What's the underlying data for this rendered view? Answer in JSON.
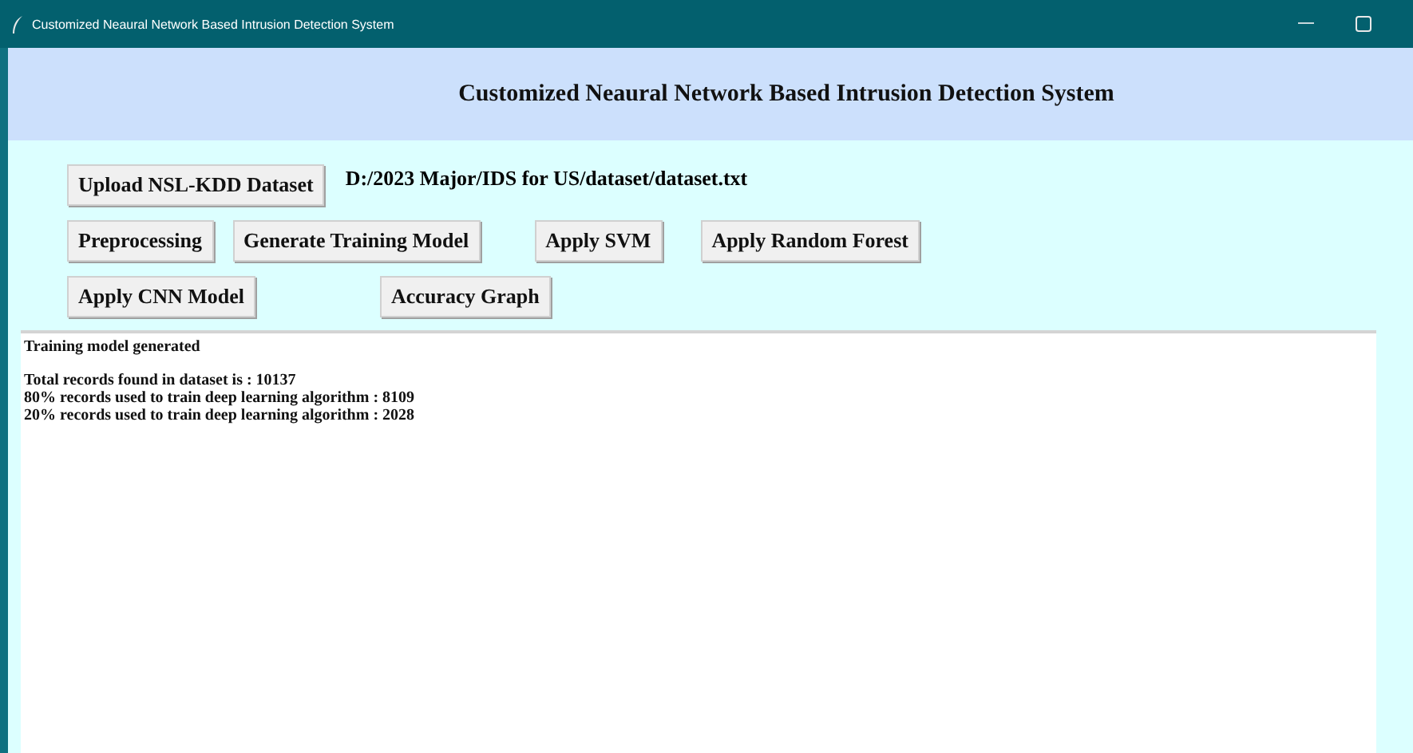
{
  "window": {
    "title": "Customized Neaural Network Based Intrusion Detection System"
  },
  "heading": "Customized Neaural Network Based Intrusion Detection System",
  "button_rows": [
    {
      "buttons": [
        "Upload NSL-KDD Dataset"
      ],
      "path": "D:/2023 Major/IDS for US/dataset/dataset.txt"
    },
    {
      "buttons": [
        "Preprocessing",
        "Generate Training Model",
        "Apply SVM",
        "Apply Random Forest"
      ]
    },
    {
      "buttons": [
        "Apply CNN Model",
        "Accuracy Graph"
      ]
    }
  ],
  "output": [
    {
      "lines": [
        "Training model generated"
      ]
    },
    {
      "lines": [
        "Total records found in dataset is : 10137",
        "80% records used to train deep learning algorithm : 8109",
        "20% records used to train deep learning algorithm : 2028"
      ]
    }
  ]
}
